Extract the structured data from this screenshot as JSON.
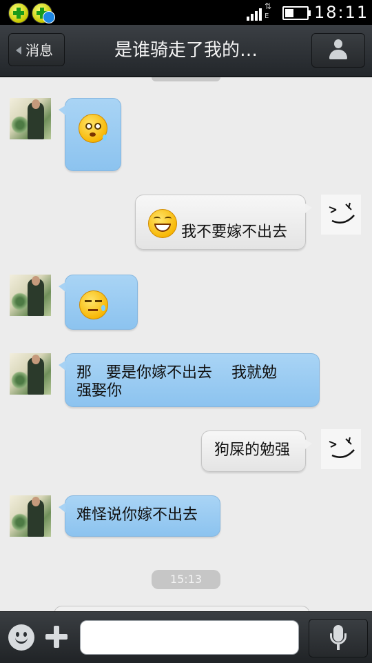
{
  "status_bar": {
    "time": "18:11",
    "network_type": "E",
    "icons": [
      "app-icon-plus",
      "app-icon-update",
      "signal-icon",
      "data-arrows-icon",
      "battery-icon"
    ]
  },
  "header": {
    "back_label": "消息",
    "title": "是谁骑走了我的…",
    "profile_icon": "person-icon"
  },
  "messages": [
    {
      "side": "in",
      "type": "emoji",
      "emoji": "dizzy-face-emoji"
    },
    {
      "side": "out",
      "type": "emoji-text",
      "emoji": "laughing-face-emoji",
      "text": "我不要嫁不出去"
    },
    {
      "side": "in",
      "type": "emoji",
      "emoji": "sweat-face-emoji"
    },
    {
      "side": "in",
      "type": "text",
      "text_line1": "那   要是你嫁不出去    我就勉",
      "text_line2": "强娶你"
    },
    {
      "side": "out",
      "type": "text",
      "text": "狗屎的勉强"
    },
    {
      "side": "in",
      "type": "text",
      "text": "难怪说你嫁不出去"
    }
  ],
  "timestamp": "15:13",
  "input_bar": {
    "emoji_icon": "smiley-icon",
    "plus_icon": "plus-icon",
    "message_value": "",
    "voice_icon": "microphone-icon"
  },
  "colors": {
    "incoming_bubble": "#9fcdf3",
    "outgoing_bubble": "#efefef",
    "chat_background": "#ececec",
    "bar_dark": "#2a2e32"
  }
}
